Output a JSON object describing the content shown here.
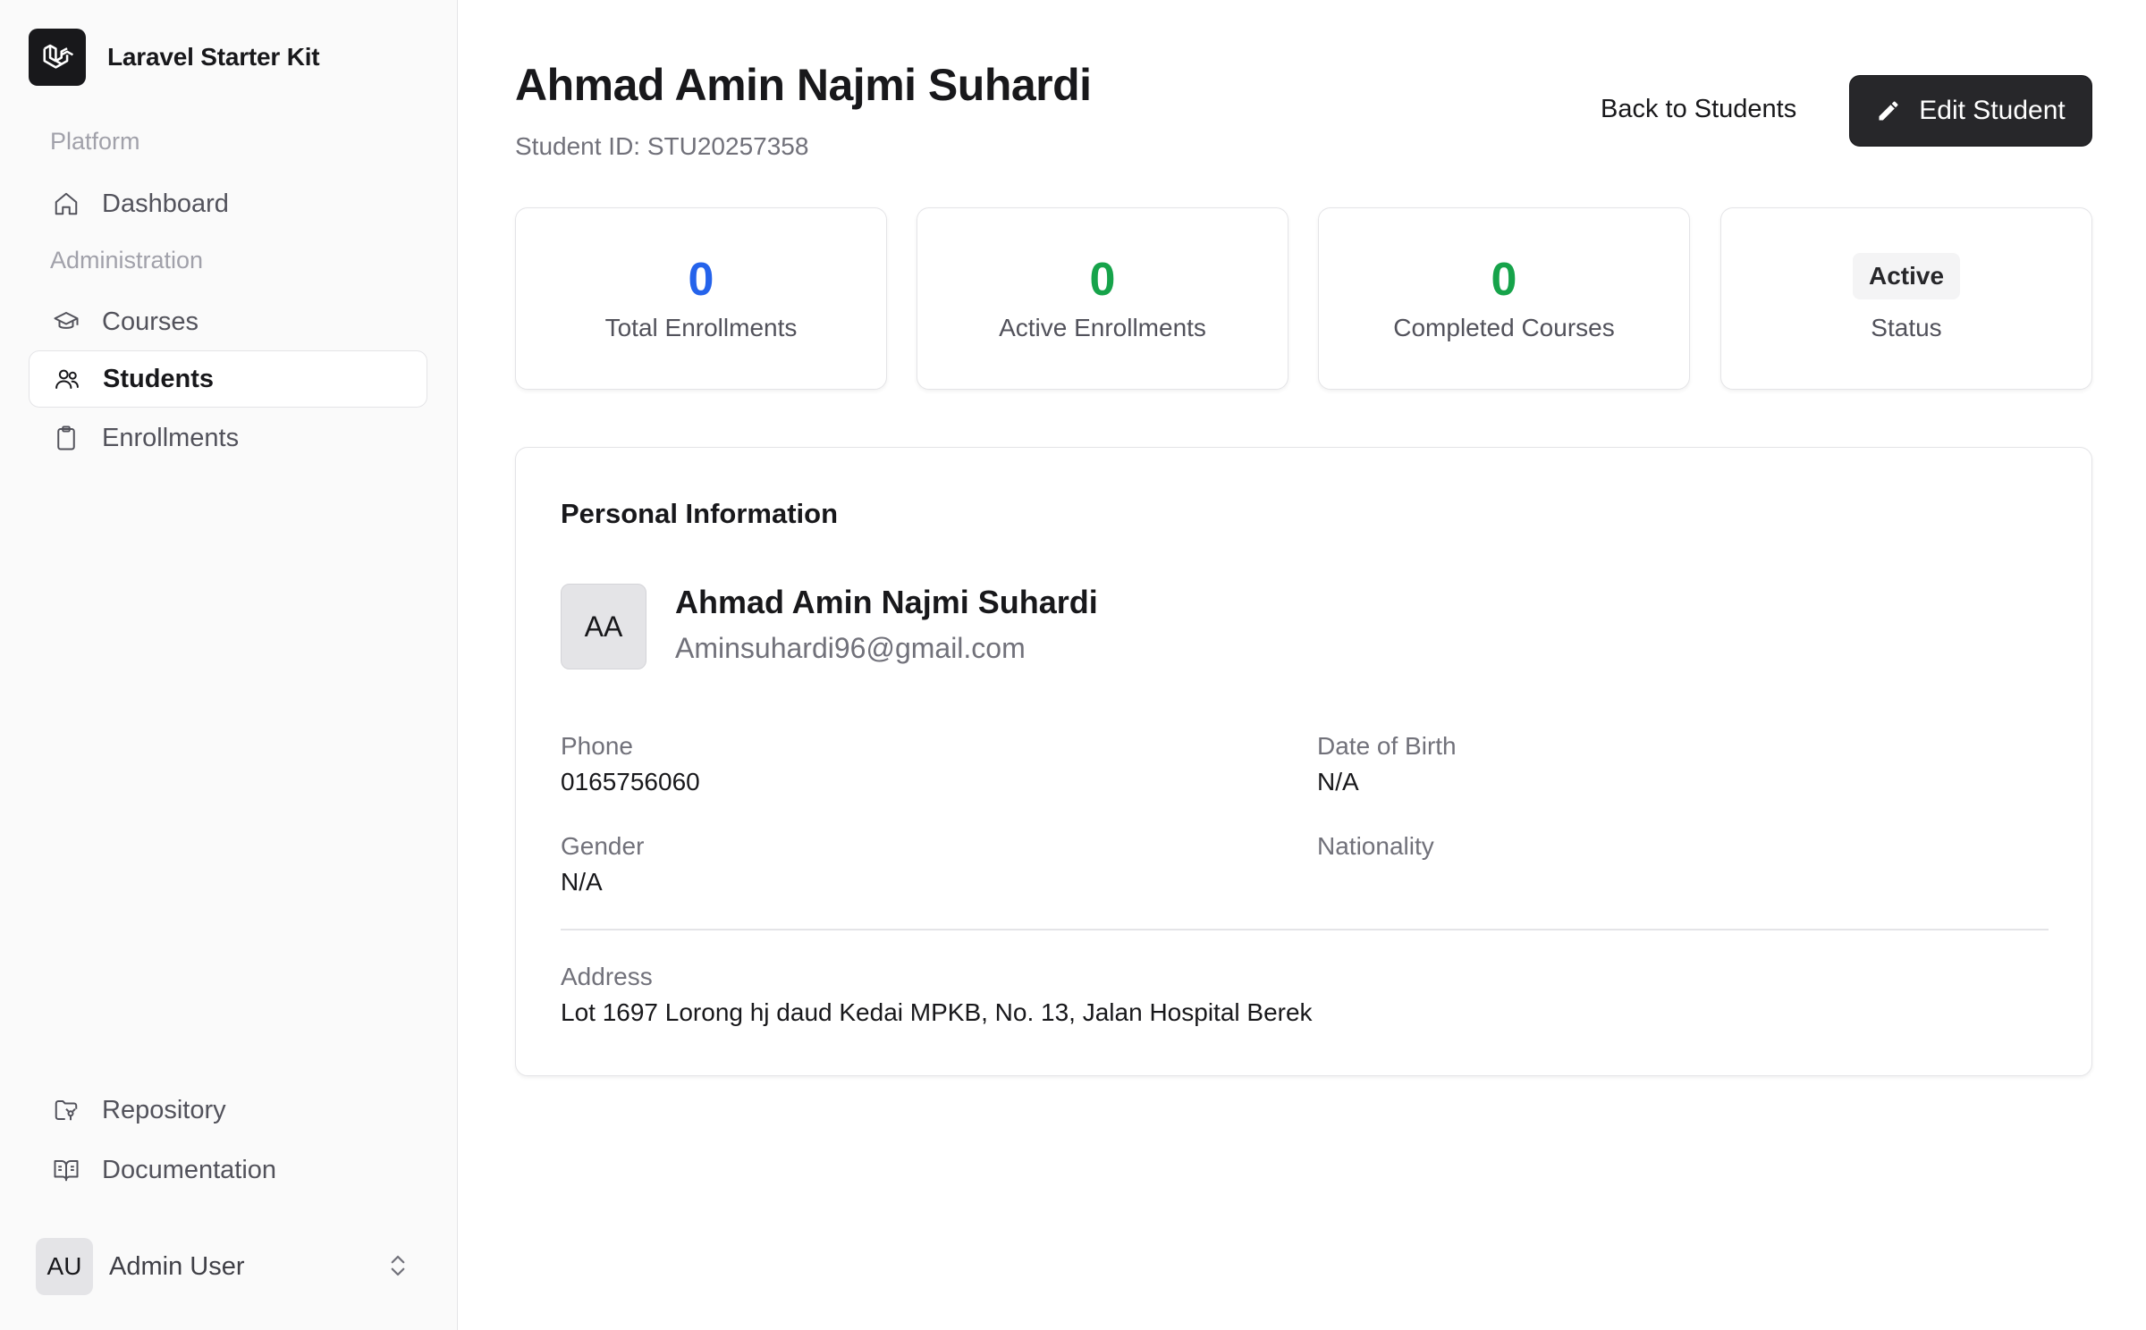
{
  "brand": {
    "name": "Laravel Starter Kit",
    "logo_icon": "laravel-logo-icon"
  },
  "sidebar": {
    "groups": [
      {
        "label": "Platform"
      },
      {
        "label": "Administration"
      }
    ],
    "items": [
      {
        "label": "Dashboard",
        "icon": "home-icon",
        "active": false
      },
      {
        "label": "Courses",
        "icon": "graduation-cap-icon",
        "active": false
      },
      {
        "label": "Students",
        "icon": "users-icon",
        "active": true
      },
      {
        "label": "Enrollments",
        "icon": "clipboard-icon",
        "active": false
      }
    ],
    "footer_items": [
      {
        "label": "Repository",
        "icon": "folder-git-icon"
      },
      {
        "label": "Documentation",
        "icon": "book-open-icon"
      }
    ],
    "user": {
      "initials": "AU",
      "name": "Admin User"
    }
  },
  "header": {
    "title": "Ahmad Amin Najmi Suhardi",
    "subtitle": "Student ID: STU20257358",
    "back_label": "Back to Students",
    "edit_label": "Edit Student"
  },
  "stats": [
    {
      "value": "0",
      "label": "Total Enrollments",
      "color": "#2563eb"
    },
    {
      "value": "0",
      "label": "Active Enrollments",
      "color": "#16a34a"
    },
    {
      "value": "0",
      "label": "Completed Courses",
      "color": "#16a34a"
    },
    {
      "badge": "Active",
      "label": "Status"
    }
  ],
  "personal": {
    "section_title": "Personal Information",
    "initials": "AA",
    "name": "Ahmad Amin Najmi Suhardi",
    "email": "Aminsuhardi96@gmail.com",
    "fields": {
      "phone_label": "Phone",
      "phone_value": "0165756060",
      "dob_label": "Date of Birth",
      "dob_value": "N/A",
      "gender_label": "Gender",
      "gender_value": "N/A",
      "nationality_label": "Nationality",
      "nationality_value": "",
      "address_label": "Address",
      "address_value": "Lot 1697 Lorong hj daud Kedai MPKB, No. 13, Jalan Hospital Berek"
    }
  }
}
